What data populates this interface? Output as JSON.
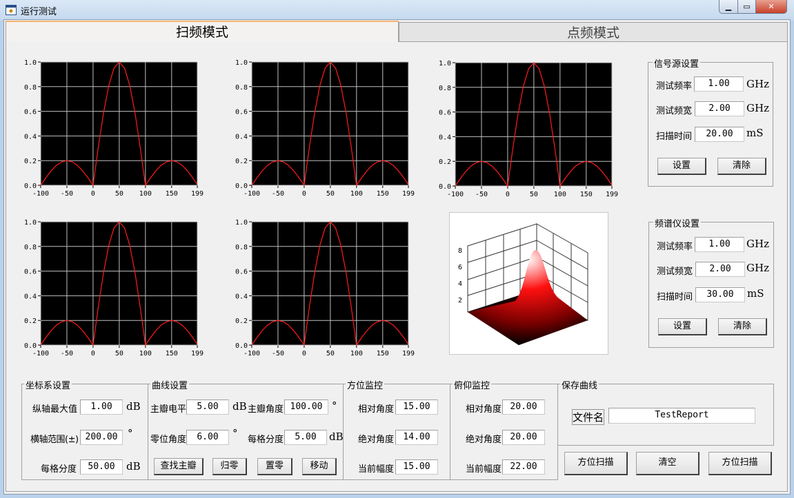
{
  "window": {
    "title": "运行测试",
    "icon": "app-window-icon",
    "controls": [
      "minimize",
      "maximize",
      "close"
    ]
  },
  "tabs": [
    {
      "label": "扫频模式",
      "active": true
    },
    {
      "label": "点频模式",
      "active": false
    }
  ],
  "colors": {
    "plot_bg": "#000000",
    "grid": "#c0c0c0",
    "curve": "#ff1a1a",
    "tab_accent": "#f3b471"
  },
  "chart_data": [
    {
      "type": "line",
      "xlim": [
        -100,
        199
      ],
      "ylim": [
        0,
        1
      ],
      "grid": true,
      "x_ticks": [
        "-100",
        "-50",
        "0",
        "50",
        "100",
        "150",
        "199"
      ],
      "y_ticks": [
        "0.0",
        "0.2",
        "0.4",
        "0.6",
        "0.8",
        "1.0"
      ],
      "x": [
        -100,
        -90,
        -80,
        -70,
        -60,
        -50,
        -40,
        -30,
        -20,
        -10,
        0,
        10,
        20,
        30,
        40,
        50,
        60,
        70,
        80,
        90,
        100,
        110,
        120,
        130,
        140,
        150,
        160,
        170,
        180,
        190,
        199
      ],
      "series": [
        {
          "values": [
            0,
            0.062,
            0.118,
            0.162,
            0.19,
            0.2,
            0.19,
            0.162,
            0.118,
            0.062,
            0,
            0.309,
            0.588,
            0.809,
            0.951,
            1,
            0.951,
            0.809,
            0.588,
            0.309,
            0,
            0.062,
            0.118,
            0.162,
            0.19,
            0.2,
            0.19,
            0.162,
            0.118,
            0.062,
            0.006
          ]
        }
      ]
    },
    {
      "type": "line",
      "xlim": [
        -100,
        199
      ],
      "ylim": [
        0,
        1
      ],
      "grid": true,
      "x_ticks": [
        "-100",
        "-50",
        "0",
        "50",
        "100",
        "150",
        "199"
      ],
      "y_ticks": [
        "0.0",
        "0.2",
        "0.4",
        "0.6",
        "0.8",
        "1.0"
      ],
      "x": [
        -100,
        -90,
        -80,
        -70,
        -60,
        -50,
        -40,
        -30,
        -20,
        -10,
        0,
        10,
        20,
        30,
        40,
        50,
        60,
        70,
        80,
        90,
        100,
        110,
        120,
        130,
        140,
        150,
        160,
        170,
        180,
        190,
        199
      ],
      "series": [
        {
          "values": [
            0,
            0.062,
            0.118,
            0.162,
            0.19,
            0.2,
            0.19,
            0.162,
            0.118,
            0.062,
            0,
            0.309,
            0.588,
            0.809,
            0.951,
            1,
            0.951,
            0.809,
            0.588,
            0.309,
            0,
            0.062,
            0.118,
            0.162,
            0.19,
            0.2,
            0.19,
            0.162,
            0.118,
            0.062,
            0.006
          ]
        }
      ]
    },
    {
      "type": "line",
      "xlim": [
        -100,
        199
      ],
      "ylim": [
        0,
        1
      ],
      "grid": true,
      "x_ticks": [
        "-100",
        "-50",
        "0",
        "50",
        "100",
        "150",
        "199"
      ],
      "y_ticks": [
        "0.0",
        "0.2",
        "0.4",
        "0.6",
        "0.8",
        "1.0"
      ],
      "x": [
        -100,
        -90,
        -80,
        -70,
        -60,
        -50,
        -40,
        -30,
        -20,
        -10,
        0,
        10,
        20,
        30,
        40,
        50,
        60,
        70,
        80,
        90,
        100,
        110,
        120,
        130,
        140,
        150,
        160,
        170,
        180,
        190,
        199
      ],
      "series": [
        {
          "values": [
            0,
            0.062,
            0.118,
            0.162,
            0.19,
            0.2,
            0.19,
            0.162,
            0.118,
            0.062,
            0,
            0.309,
            0.588,
            0.809,
            0.951,
            1,
            0.951,
            0.809,
            0.588,
            0.309,
            0,
            0.062,
            0.118,
            0.162,
            0.19,
            0.2,
            0.19,
            0.162,
            0.118,
            0.062,
            0.006
          ]
        }
      ]
    },
    {
      "type": "line",
      "xlim": [
        -100,
        199
      ],
      "ylim": [
        0,
        1
      ],
      "grid": true,
      "x_ticks": [
        "-100",
        "-50",
        "0",
        "50",
        "100",
        "150",
        "199"
      ],
      "y_ticks": [
        "0.0",
        "0.2",
        "0.4",
        "0.6",
        "0.8",
        "1.0"
      ],
      "x": [
        -100,
        -90,
        -80,
        -70,
        -60,
        -50,
        -40,
        -30,
        -20,
        -10,
        0,
        10,
        20,
        30,
        40,
        50,
        60,
        70,
        80,
        90,
        100,
        110,
        120,
        130,
        140,
        150,
        160,
        170,
        180,
        190,
        199
      ],
      "series": [
        {
          "values": [
            0,
            0.062,
            0.118,
            0.162,
            0.19,
            0.2,
            0.19,
            0.162,
            0.118,
            0.062,
            0,
            0.309,
            0.588,
            0.809,
            0.951,
            1,
            0.951,
            0.809,
            0.588,
            0.309,
            0,
            0.062,
            0.118,
            0.162,
            0.19,
            0.2,
            0.19,
            0.162,
            0.118,
            0.062,
            0.006
          ]
        }
      ]
    },
    {
      "type": "line",
      "xlim": [
        -100,
        199
      ],
      "ylim": [
        0,
        1
      ],
      "grid": true,
      "x_ticks": [
        "-100",
        "-50",
        "0",
        "50",
        "100",
        "150",
        "199"
      ],
      "y_ticks": [
        "0.0",
        "0.2",
        "0.4",
        "0.6",
        "0.8",
        "1.0"
      ],
      "x": [
        -100,
        -90,
        -80,
        -70,
        -60,
        -50,
        -40,
        -30,
        -20,
        -10,
        0,
        10,
        20,
        30,
        40,
        50,
        60,
        70,
        80,
        90,
        100,
        110,
        120,
        130,
        140,
        150,
        160,
        170,
        180,
        190,
        199
      ],
      "series": [
        {
          "values": [
            0,
            0.062,
            0.118,
            0.162,
            0.19,
            0.2,
            0.19,
            0.162,
            0.118,
            0.062,
            0,
            0.309,
            0.588,
            0.809,
            0.951,
            1,
            0.951,
            0.809,
            0.588,
            0.309,
            0,
            0.062,
            0.118,
            0.162,
            0.19,
            0.2,
            0.19,
            0.162,
            0.118,
            0.062,
            0.006
          ]
        }
      ]
    },
    {
      "type": "surface3d",
      "z_ticks": [
        "2",
        "4",
        "6",
        "8"
      ],
      "colormap": "black-red-white"
    }
  ],
  "signal_source": {
    "title": "信号源设置",
    "rows": [
      {
        "label": "测试频率",
        "value": "1.00",
        "unit": "GHz"
      },
      {
        "label": "测试频宽",
        "value": "2.00",
        "unit": "GHz"
      },
      {
        "label": "扫描时间",
        "value": "20.00",
        "unit": "mS"
      }
    ],
    "set_label": "设置",
    "clear_label": "清除"
  },
  "spectrum": {
    "title": "频谱仪设置",
    "rows": [
      {
        "label": "测试频率",
        "value": "1.00",
        "unit": "GHz"
      },
      {
        "label": "测试频宽",
        "value": "2.00",
        "unit": "GHz"
      },
      {
        "label": "扫描时间",
        "value": "30.00",
        "unit": "mS"
      }
    ],
    "set_label": "设置",
    "clear_label": "清除"
  },
  "axis_settings": {
    "title": "坐标系设置",
    "rows": [
      {
        "label": "纵轴最大值",
        "value": "1.00",
        "unit": "dB"
      },
      {
        "label": "横轴范围(±)",
        "value": "200.00",
        "unit": "°"
      },
      {
        "label": "每格分度",
        "value": "50.00",
        "unit": "dB"
      }
    ]
  },
  "curve_settings": {
    "title": "曲线设置",
    "main_level": {
      "label": "主瓣电平",
      "value": "5.00",
      "unit": "dB"
    },
    "main_angle": {
      "label": "主瓣角度",
      "value": "100.00",
      "unit": "°"
    },
    "zero_angle": {
      "label": "零位角度",
      "value": "6.00",
      "unit": "°"
    },
    "per_div": {
      "label": "每格分度",
      "value": "5.00",
      "unit": "dB"
    },
    "buttons": [
      "查找主瓣",
      "归零",
      "置零",
      "移动"
    ]
  },
  "azimuth": {
    "title": "方位监控",
    "rows": [
      {
        "label": "相对角度",
        "value": "15.00"
      },
      {
        "label": "绝对角度",
        "value": "14.00"
      },
      {
        "label": "当前幅度",
        "value": "15.00"
      }
    ]
  },
  "elevation": {
    "title": "俯仰监控",
    "rows": [
      {
        "label": "相对角度",
        "value": "20.00"
      },
      {
        "label": "绝对角度",
        "value": "20.00"
      },
      {
        "label": "当前幅度",
        "value": "22.00"
      }
    ]
  },
  "save": {
    "title": "保存曲线",
    "filename_label": "文件名",
    "filename_value": "TestReport"
  },
  "bottom_buttons": [
    "方位扫描",
    "清空",
    "方位扫描"
  ]
}
